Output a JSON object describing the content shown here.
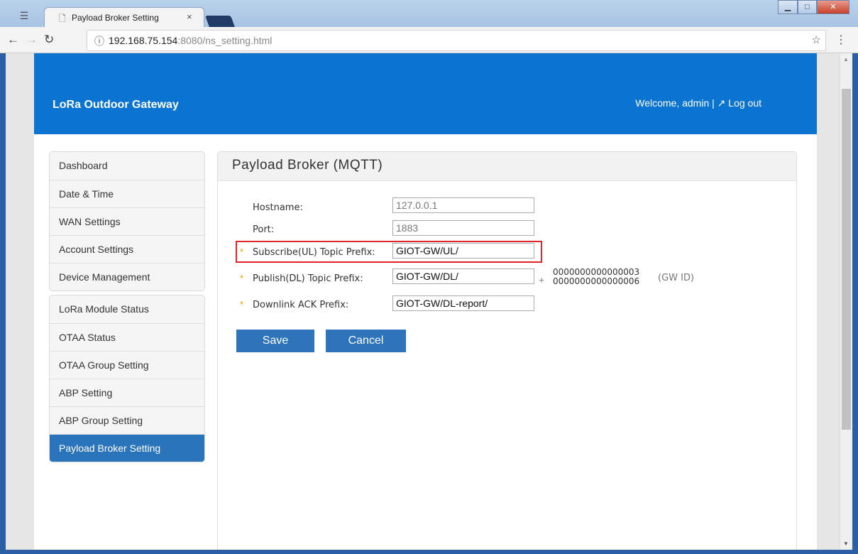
{
  "browser": {
    "tab_title": "Payload Broker Setting",
    "tab_close": "×",
    "url_host": "192.168.75.154",
    "url_rest": ":8080/ns_setting.html"
  },
  "header": {
    "brand": "LoRa Outdoor Gateway",
    "welcome": "Welcome, admin |",
    "logout": "Log out"
  },
  "sidebar": {
    "group1": [
      "Dashboard",
      "Date & Time",
      "WAN Settings",
      "Account Settings",
      "Device Management"
    ],
    "group2": [
      "LoRa Module Status",
      "OTAA Status",
      "OTAA Group Setting",
      "ABP Setting",
      "ABP Group Setting",
      "Payload Broker Setting"
    ],
    "active": "Payload Broker Setting"
  },
  "panel": {
    "title": "Payload Broker (MQTT)",
    "fields": {
      "hostname": {
        "label": "Hostname:",
        "value": "127.0.0.1"
      },
      "port": {
        "label": "Port:",
        "value": "1883"
      },
      "subscribe": {
        "label": "Subscribe(UL) Topic Prefix:",
        "value": "GIOT-GW/UL/"
      },
      "publish": {
        "label": "Publish(DL) Topic Prefix:",
        "value": "GIOT-GW/DL/"
      },
      "ack": {
        "label": "Downlink ACK Prefix:",
        "value": "GIOT-GW/DL-report/"
      }
    },
    "required_mark": "*",
    "plus": "+",
    "gw_ids": [
      "0000000000000003",
      "0000000000000006"
    ],
    "gw_id_label": "(GW ID)",
    "save": "Save",
    "cancel": "Cancel"
  },
  "colors": {
    "header_bg": "#0a74d0",
    "active_item": "#2a74bc",
    "button": "#2e74bb",
    "highlight": "#e0242a",
    "required": "#e8a100"
  }
}
